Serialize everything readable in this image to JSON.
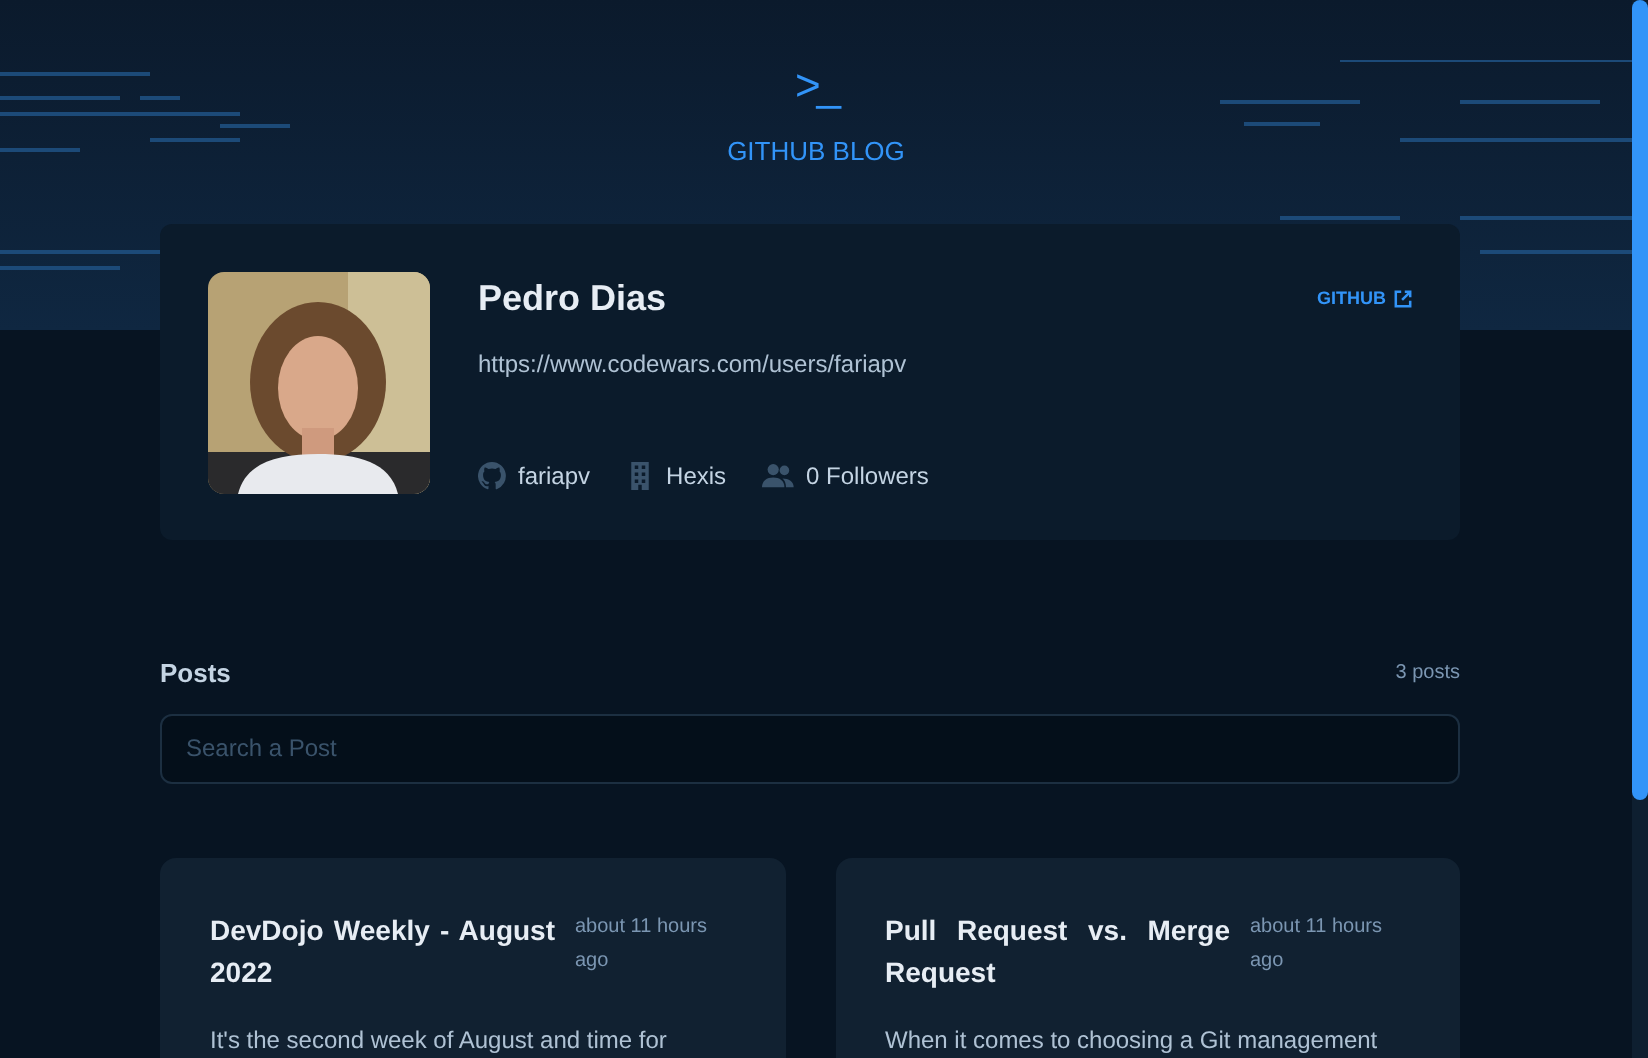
{
  "header": {
    "logo_symbol": ">_",
    "title": "GITHUB BLOG"
  },
  "profile": {
    "name": "Pedro Dias",
    "link": "GITHUB",
    "url": "https://www.codewars.com/users/fariapv",
    "stats": [
      {
        "kind": "github",
        "text": "fariapv"
      },
      {
        "kind": "company",
        "text": "Hexis"
      },
      {
        "kind": "followers",
        "text": "0 Followers"
      }
    ]
  },
  "posts": {
    "heading": "Posts",
    "count": "3 posts",
    "search": {
      "placeholder": "Search a Post"
    },
    "items": [
      {
        "title": "DevDojo Weekly - August 2022",
        "time": "about 11 hours ago",
        "excerpt": "It's the second week of August and time for"
      },
      {
        "title": "Pull Request vs. Merge Request",
        "time": "about 11 hours ago",
        "excerpt": "When it comes to choosing a Git management"
      }
    ]
  }
}
